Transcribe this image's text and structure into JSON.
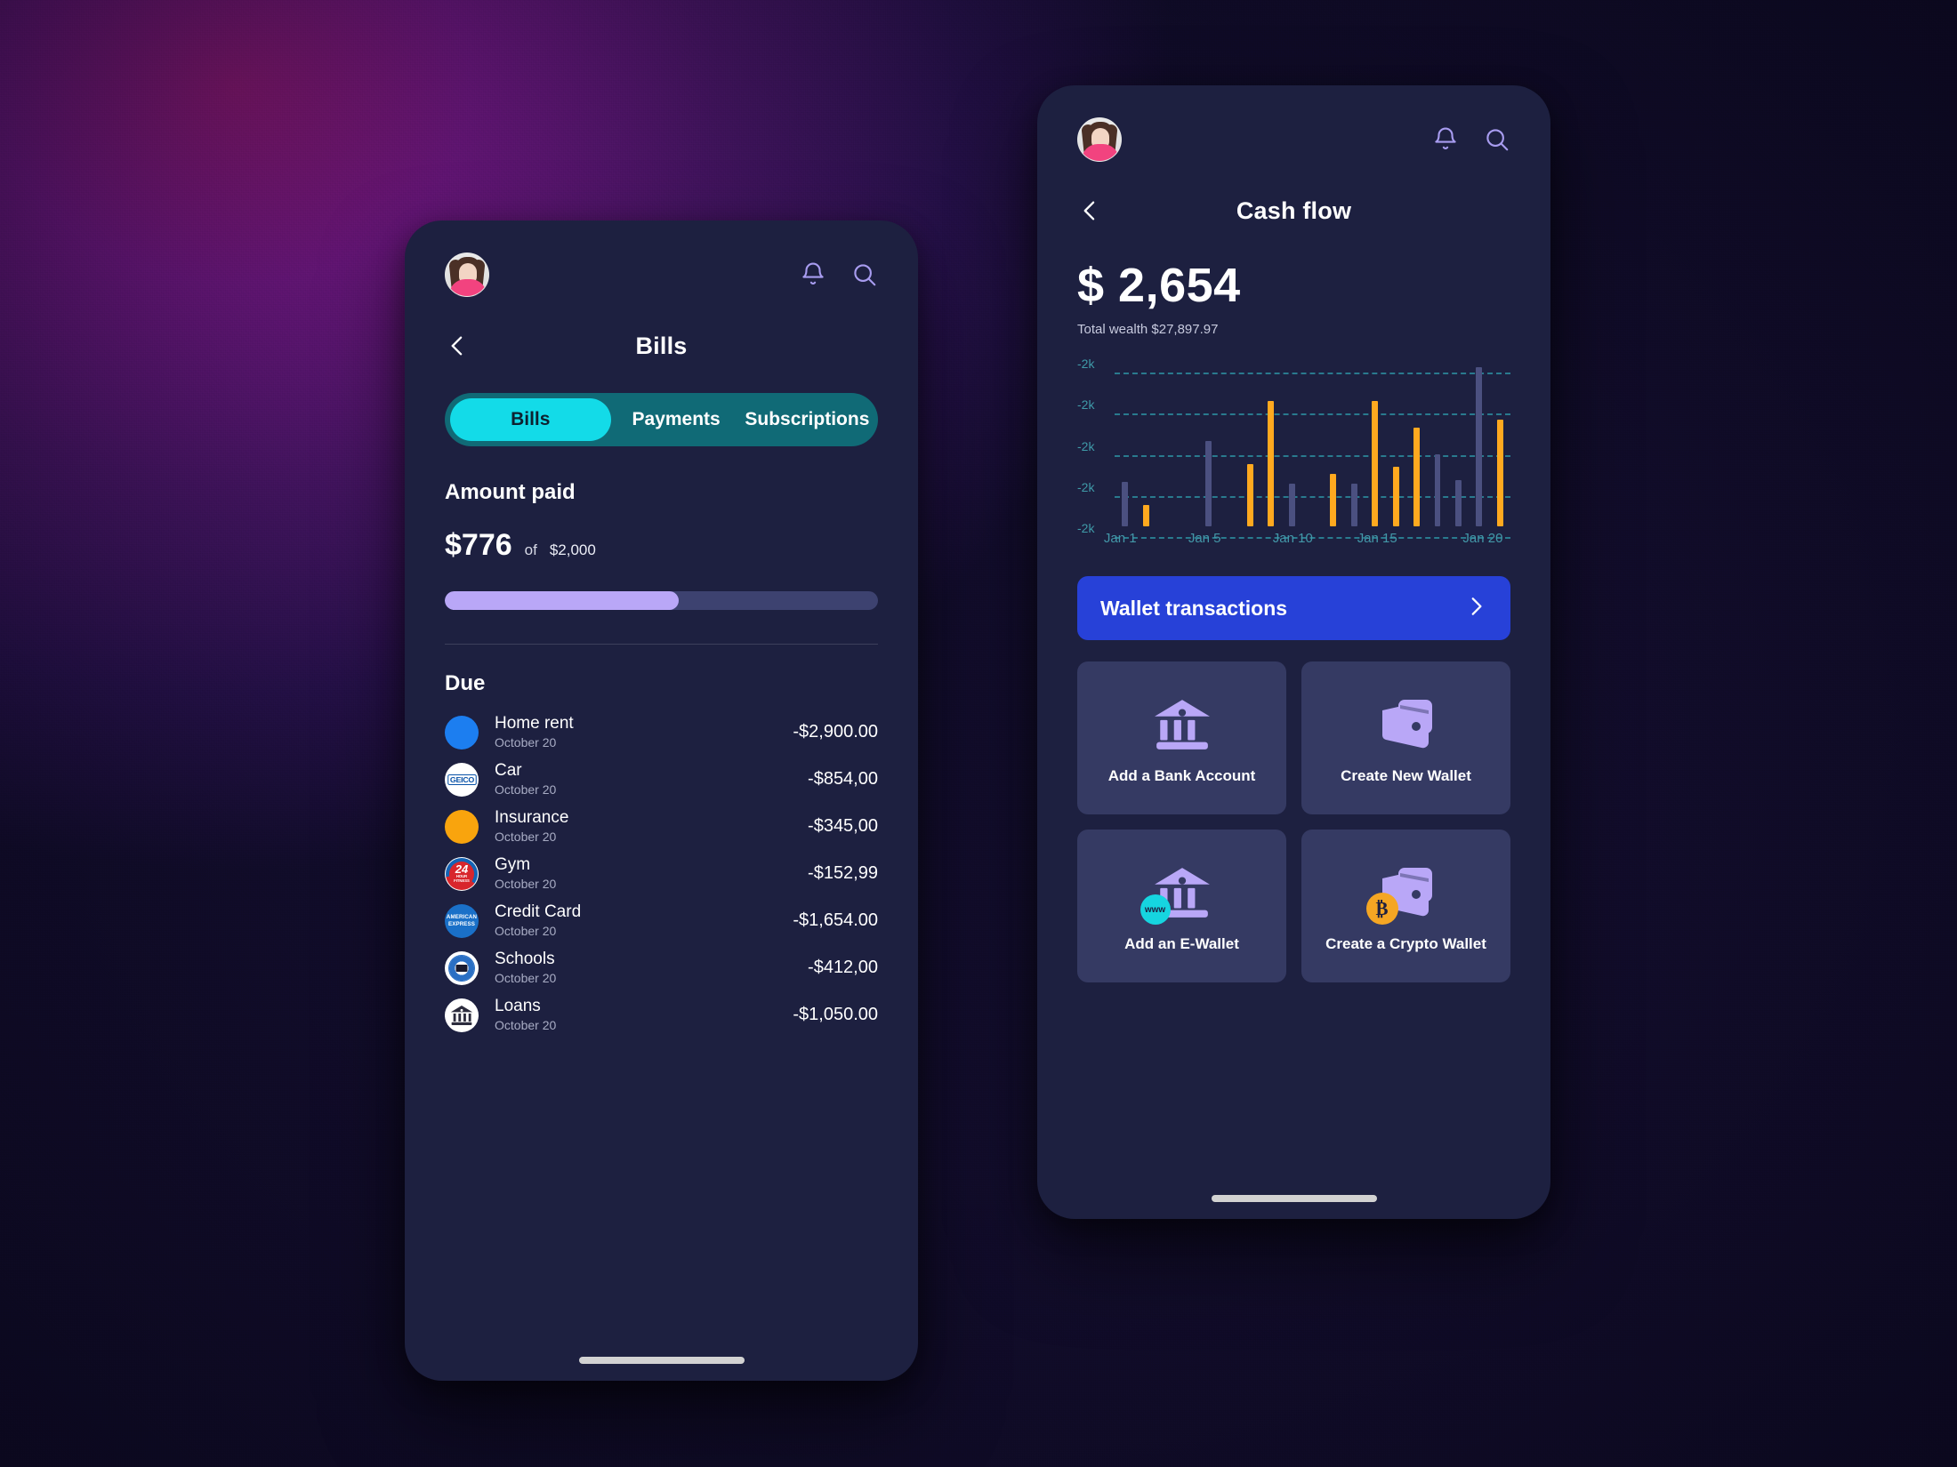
{
  "background": {
    "accent_magenta": "#8f1a86",
    "accent_blue": "#2b2ea8",
    "base": "#0f1026"
  },
  "bills_screen": {
    "avatar_name": "user-avatar",
    "icons": {
      "bell": "bell-icon",
      "search": "search-icon",
      "back": "back-chevron-icon"
    },
    "title": "Bills",
    "tabs": [
      {
        "label": "Bills",
        "active": true
      },
      {
        "label": "Payments",
        "active": false
      },
      {
        "label": "Subscriptions",
        "active": false
      }
    ],
    "amount_paid": {
      "heading": "Amount paid",
      "value": "$776",
      "of_word": "of",
      "total": "$2,000",
      "progress_percent": 54
    },
    "due": {
      "heading": "Due",
      "items": [
        {
          "name": "Home rent",
          "date": "October 20",
          "amount": "-$2,900.00",
          "icon": "dot-blue",
          "color": "#1c7ef0"
        },
        {
          "name": "Car",
          "date": "October 20",
          "amount": "-$854,00",
          "icon": "geico-logo",
          "color": "#ffffff"
        },
        {
          "name": "Insurance",
          "date": "October 20",
          "amount": "-$345,00",
          "icon": "dot-orange",
          "color": "#f9a40d"
        },
        {
          "name": "Gym",
          "date": "October 20",
          "amount": "-$152,99",
          "icon": "24hour-fitness-logo",
          "color": "#ffffff"
        },
        {
          "name": "Credit Card",
          "date": "October 20",
          "amount": "-$1,654.00",
          "icon": "amex-logo",
          "color": "#1a70c8"
        },
        {
          "name": "Schools",
          "date": "October 20",
          "amount": "-$412,00",
          "icon": "school-crest-logo",
          "color": "#ffffff"
        },
        {
          "name": "Loans",
          "date": "October 20",
          "amount": "-$1,050.00",
          "icon": "bank-icon",
          "color": "#ffffff"
        }
      ]
    }
  },
  "cashflow_screen": {
    "icons": {
      "bell": "bell-icon",
      "search": "search-icon",
      "back": "back-chevron-icon"
    },
    "title": "Cash flow",
    "balance": "$ 2,654",
    "total_wealth": "Total wealth $27,897.97",
    "wallet_button": {
      "label": "Wallet transactions",
      "chevron": "chevron-right-icon"
    },
    "cards": [
      {
        "label": "Add a Bank Account",
        "icon": "bank-icon",
        "badge": null
      },
      {
        "label": "Create New Wallet",
        "icon": "wallet-icon",
        "badge": null
      },
      {
        "label": "Add an E-Wallet",
        "icon": "bank-icon",
        "badge": "www"
      },
      {
        "label": "Create a Crypto Wallet",
        "icon": "wallet-icon",
        "badge": "bitcoin"
      }
    ]
  },
  "chart_data": {
    "type": "bar",
    "title": "",
    "xlabel": "",
    "ylabel": "",
    "grid": true,
    "legend": false,
    "colors": {
      "positive": "#ffa91f",
      "negative": "#4b5080",
      "grid": "#2c8a9c",
      "ticks": "#4397a8"
    },
    "ytick_labels": [
      "-2k",
      "-2k",
      "-2k",
      "-2k",
      "-2k"
    ],
    "ytick_positions": [
      100,
      75,
      50,
      25,
      0
    ],
    "xtick_labels": [
      "Jan 1",
      "Jan 5",
      "Jan 10",
      "Jan 15",
      "Jan 20"
    ],
    "xtick_bar_index": [
      0,
      4,
      8,
      12,
      17
    ],
    "series": [
      {
        "name": "Cash flow",
        "values": [
          27,
          13,
          0,
          0,
          52,
          0,
          38,
          76,
          26,
          0,
          32,
          26,
          76,
          36,
          60,
          44,
          28,
          97,
          65
        ]
      }
    ],
    "bar_types": [
      "dn",
      "up",
      "none",
      "none",
      "dn",
      "none",
      "up",
      "up",
      "dn",
      "none",
      "up",
      "dn",
      "up",
      "up",
      "up",
      "dn",
      "dn",
      "dn",
      "up"
    ],
    "values": [
      27,
      13,
      0,
      0,
      52,
      0,
      38,
      76,
      26,
      0,
      32,
      26,
      76,
      36,
      60,
      44,
      28,
      97,
      65
    ],
    "categories": [
      "1",
      "2",
      "3",
      "4",
      "5",
      "6",
      "7",
      "8",
      "9",
      "10",
      "11",
      "12",
      "13",
      "14",
      "15",
      "16",
      "17",
      "18",
      "19"
    ],
    "ylim": [
      0,
      100
    ]
  }
}
